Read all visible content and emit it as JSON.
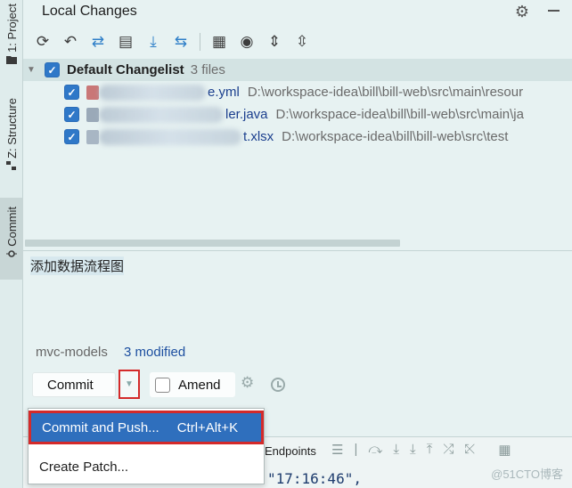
{
  "side_strip": {
    "tabs": [
      {
        "label": "1: Project"
      },
      {
        "label": "Z: Structure"
      },
      {
        "label": "Commit"
      }
    ]
  },
  "header": {
    "title": "Local Changes"
  },
  "toolbar": {
    "icons": [
      "refresh-icon",
      "rollback-icon",
      "diff-icon",
      "shelve-icon",
      "download-icon",
      "move-icon",
      "group-icon",
      "eye-icon",
      "expand-icon",
      "collapse-icon"
    ]
  },
  "changelist": {
    "name": "Default Changelist",
    "count": "3 files",
    "files": [
      {
        "name": "e.yml",
        "path": "D:\\workspace-idea\\bill\\bill-web\\src\\main\\resour"
      },
      {
        "name": "ler.java",
        "path": "D:\\workspace-idea\\bill\\bill-web\\src\\main\\ja"
      },
      {
        "name": "t.xlsx",
        "path": "D:\\workspace-idea\\bill\\bill-web\\src\\test"
      }
    ]
  },
  "commit_message": "添加数据流程图",
  "status": {
    "branch": "mvc-models",
    "modified": "3 modified"
  },
  "commit": {
    "button": "Commit",
    "amend": "Amend"
  },
  "popup": {
    "items": [
      {
        "label": "Commit and Push...",
        "shortcut": "Ctrl+Alt+K"
      },
      {
        "label": "Create Patch..."
      }
    ]
  },
  "background": {
    "endpoints": "Endpoints",
    "code": "\"17:16:46\",",
    "watermark": "@51CTO博客"
  },
  "colors": {
    "accent": "#2f6fbd",
    "highlight_box": "#d42a2a",
    "panel_bg": "#e7f2f2"
  }
}
